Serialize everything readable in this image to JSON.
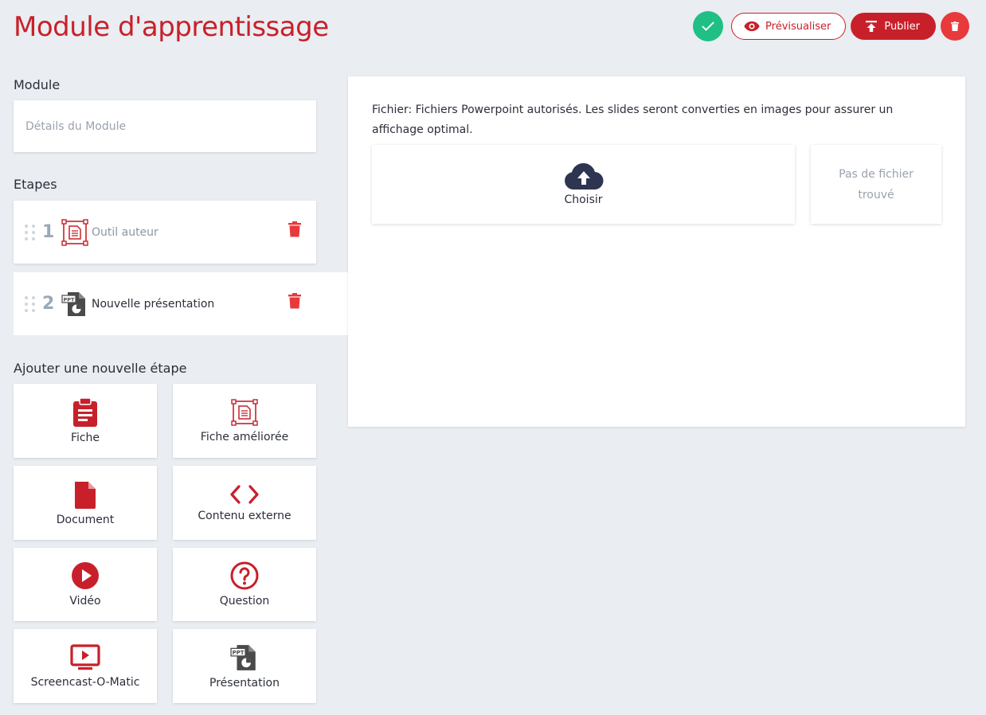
{
  "header": {
    "title": "Module d'apprentissage",
    "preview_label": "Prévisualiser",
    "publish_label": "Publier"
  },
  "module": {
    "section_label": "Module",
    "details_placeholder": "Détails du Module"
  },
  "steps": {
    "section_label": "Etapes",
    "items": [
      {
        "number": "1",
        "label": "Outil auteur",
        "icon": "authoring-tool-icon"
      },
      {
        "number": "2",
        "label": "Nouvelle présentation",
        "icon": "ppt-icon"
      }
    ]
  },
  "add_step": {
    "section_label": "Ajouter une nouvelle étape",
    "tiles": [
      {
        "label": "Fiche",
        "icon": "clipboard-icon"
      },
      {
        "label": "Fiche améliorée",
        "icon": "enhanced-sheet-icon"
      },
      {
        "label": "Document",
        "icon": "document-icon"
      },
      {
        "label": "Contenu externe",
        "icon": "code-icon"
      },
      {
        "label": "Vidéo",
        "icon": "play-icon"
      },
      {
        "label": "Question",
        "icon": "question-icon"
      },
      {
        "label": "Screencast-O-Matic",
        "icon": "screencast-icon"
      },
      {
        "label": "Présentation",
        "icon": "ppt-icon"
      }
    ]
  },
  "editor": {
    "file_info": "Fichier: Fichiers Powerpoint autorisés. Les slides seront converties en images pour assurer un affichage optimal.",
    "choose_label": "Choisir",
    "no_file_label": "Pas de fichier trouvé"
  },
  "colors": {
    "accent": "#c8202a",
    "success": "#1fbf85",
    "danger": "#e8393b",
    "background": "#eaedf1"
  }
}
